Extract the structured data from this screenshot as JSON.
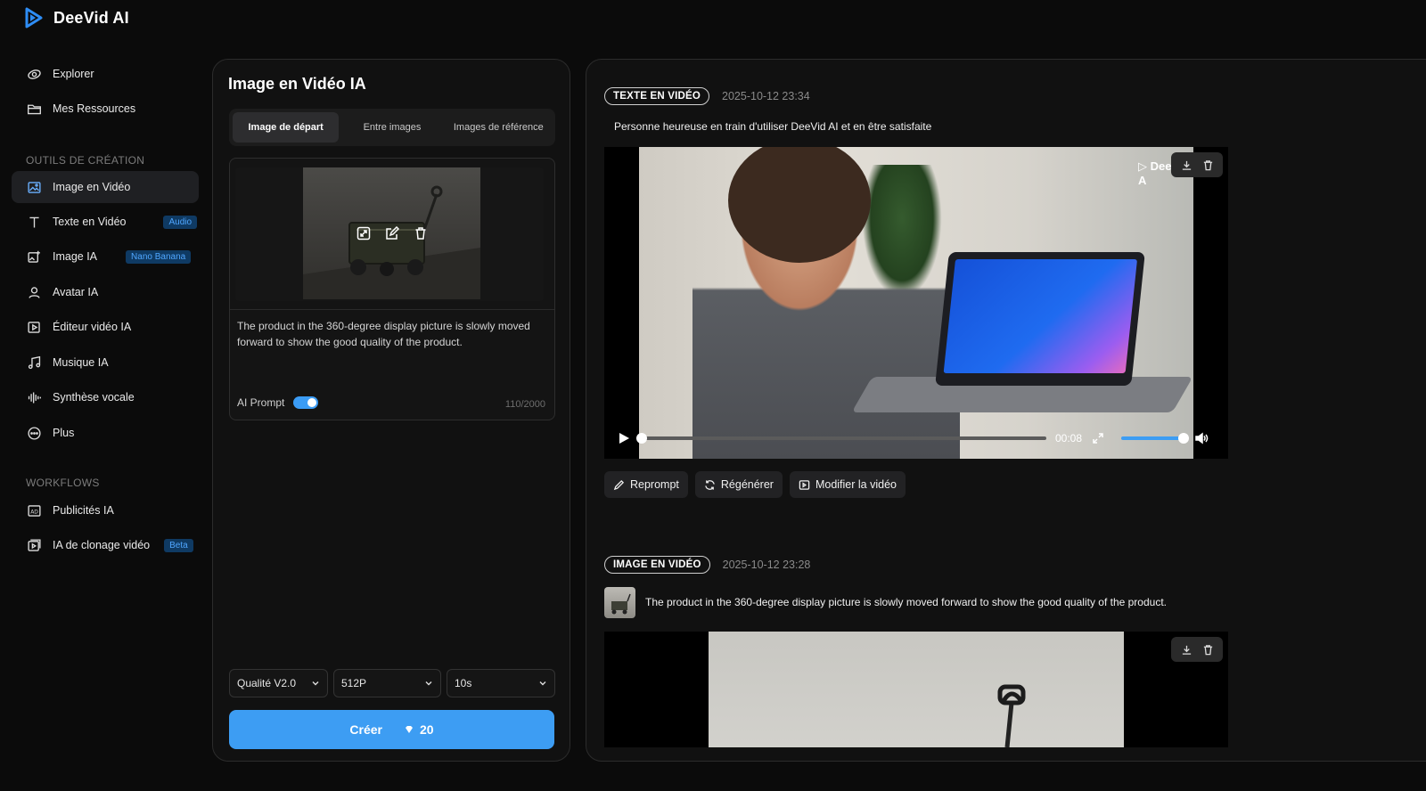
{
  "brand": {
    "name": "DeeVid AI"
  },
  "sidebar": {
    "nav_top": [
      {
        "label": "Explorer",
        "icon": "explore-icon"
      },
      {
        "label": "Mes Ressources",
        "icon": "folder-icon"
      }
    ],
    "section_tools": "OUTILS DE CRÉATION",
    "tools": [
      {
        "label": "Image en Vidéo",
        "icon": "image-icon",
        "active": true
      },
      {
        "label": "Texte en Vidéo",
        "icon": "text-icon",
        "badge": "Audio"
      },
      {
        "label": "Image IA",
        "icon": "image-edit-icon",
        "badge": "Nano Banana"
      },
      {
        "label": "Avatar IA",
        "icon": "user-icon"
      },
      {
        "label": "Éditeur vidéo IA",
        "icon": "video-edit-icon"
      },
      {
        "label": "Musique IA",
        "icon": "music-icon"
      },
      {
        "label": "Synthèse vocale",
        "icon": "waveform-icon"
      },
      {
        "label": "Plus",
        "icon": "more-icon"
      }
    ],
    "section_workflows": "WORKFLOWS",
    "workflows": [
      {
        "label": "Publicités IA",
        "icon": "ad-icon"
      },
      {
        "label": "IA de clonage vidéo",
        "icon": "clone-icon",
        "badge": "Beta"
      }
    ]
  },
  "create": {
    "title": "Image en Vidéo IA",
    "tabs": [
      "Image de départ",
      "Entre images",
      "Images de référence"
    ],
    "active_tab": 0,
    "prompt": "The product in the 360-degree display picture is slowly moved forward to show the good quality of the product.",
    "ai_prompt_label": "AI Prompt",
    "ai_prompt_enabled": true,
    "char_count": "110/2000",
    "quality": "Qualité V2.0",
    "resolution": "512P",
    "duration": "10s",
    "create_label": "Créer",
    "cost": "20"
  },
  "results": [
    {
      "type": "TEXTE EN VIDÉO",
      "timestamp": "2025-10-12 23:34",
      "prompt": "Personne heureuse en train d'utiliser DeeVid AI et en être satisfaite",
      "watermark": "DeeVid A",
      "time": "00:08",
      "progress": 0.0,
      "volume": 1.0,
      "actions": [
        "Reprompt",
        "Régénérer",
        "Modifier la vidéo"
      ]
    },
    {
      "type": "IMAGE EN VIDÉO",
      "timestamp": "2025-10-12 23:28",
      "prompt": "The product in the 360-degree display picture is slowly moved forward to show the good quality of the product."
    }
  ],
  "colors": {
    "accent": "#3d9df3",
    "badge_bg": "#0f3a63",
    "badge_text": "#4fa6ff"
  }
}
